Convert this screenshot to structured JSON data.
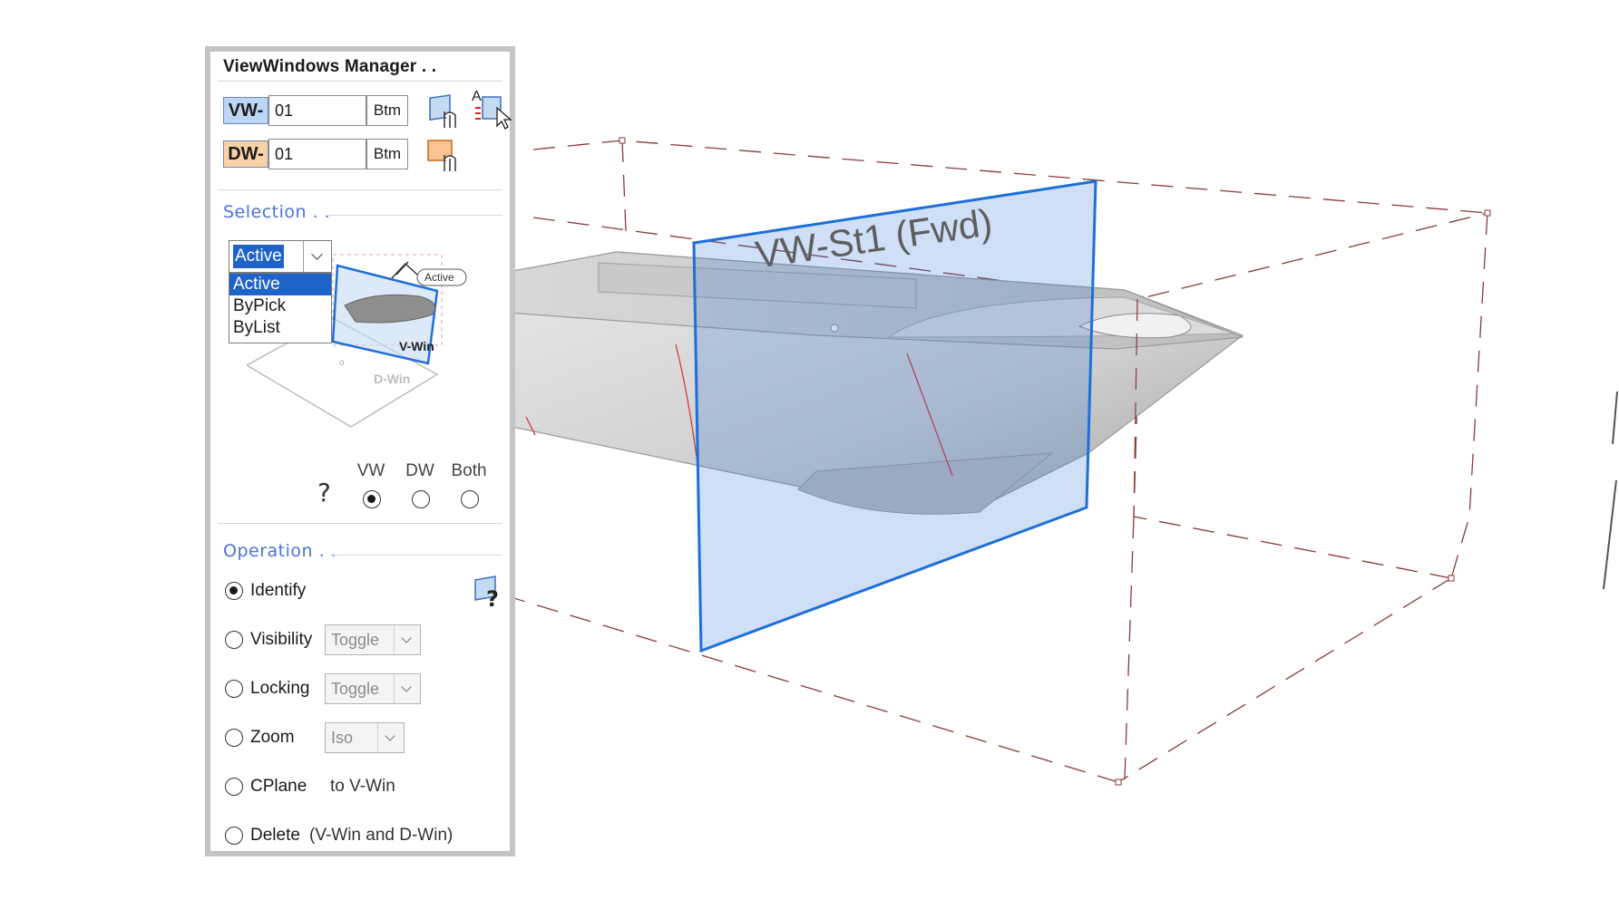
{
  "panel": {
    "title": "ViewWindows Manager . .",
    "vw": {
      "tag": "VW-",
      "value": "01",
      "unit": "Btm",
      "tag_color": "#bcd7f5"
    },
    "dw": {
      "tag": "DW-",
      "value": "01",
      "unit": "Btm",
      "tag_color": "#f9d1a6"
    },
    "selection": {
      "title": "Selection . .",
      "dropdown_value": "Active",
      "options": [
        "Active",
        "ByPick",
        "ByList"
      ],
      "illustration": {
        "active_badge": "Active",
        "vwin_label": "V-Win",
        "dwin_label": "D-Win"
      },
      "help_glyph": "?",
      "target_labels": [
        "VW",
        "DW",
        "Both"
      ],
      "target_selected": "VW"
    },
    "operation": {
      "title": "Operation . .",
      "selected": "Identify",
      "items": [
        {
          "label": "Identify"
        },
        {
          "label": "Visibility",
          "combo": "Toggle"
        },
        {
          "label": "Locking",
          "combo": "Toggle"
        },
        {
          "label": "Zoom",
          "combo": "Iso"
        },
        {
          "label": "CPlane",
          "suffix": "to V-Win"
        },
        {
          "label": "Delete",
          "suffix": "(V-Win and D-Win)"
        }
      ]
    }
  },
  "viewport": {
    "window_label": "VW-St1 (Fwd)",
    "plane_color": "#1f6fd8",
    "bbox_color": "#8a3a3a",
    "hull_color": "#d0d0d0"
  }
}
